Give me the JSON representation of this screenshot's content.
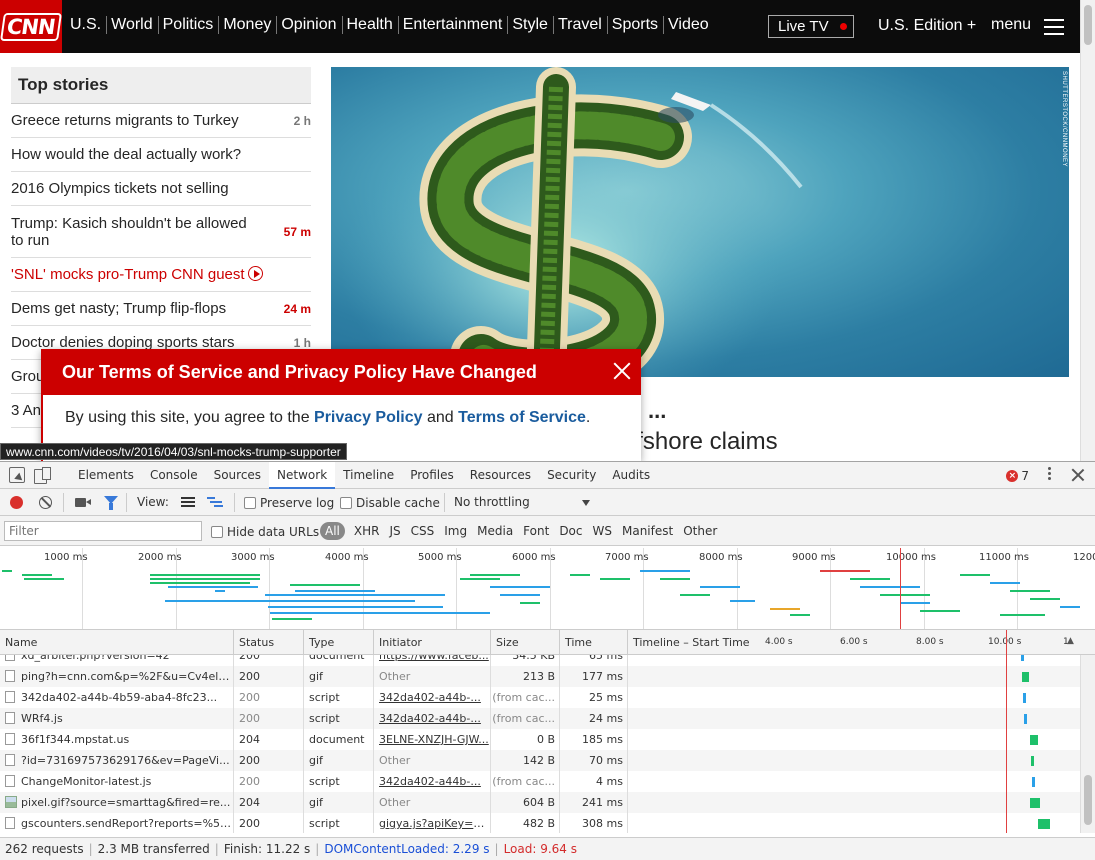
{
  "site": {
    "logo_text": "CNN",
    "nav_links": [
      "U.S.",
      "World",
      "Politics",
      "Money",
      "Opinion",
      "Health",
      "Entertainment",
      "Style",
      "Travel",
      "Sports",
      "Video"
    ],
    "live_tv": "Live TV",
    "edition": "U.S. Edition +",
    "menu": "menu",
    "top_stories": {
      "title": "Top stories",
      "items": [
        {
          "text": "Greece returns migrants to Turkey",
          "age": "2 h",
          "hot": false
        },
        {
          "text": "How would the deal actually work?",
          "age": "",
          "hot": false
        },
        {
          "text": "2016 Olympics tickets not selling",
          "age": "",
          "hot": false
        },
        {
          "text": "Trump: Kasich shouldn't be allowed to run",
          "age": "57 m",
          "hot": true
        },
        {
          "text": "'SNL' mocks pro-Trump CNN guest",
          "age": "",
          "hot": false,
          "video": true
        },
        {
          "text": "Dems get nasty; Trump flip-flops",
          "age": "24 m",
          "hot": true
        },
        {
          "text": "Doctor denies doping sports stars",
          "age": "1 h",
          "hot": false
        },
        {
          "text": "Grou",
          "age": "",
          "hot": false
        },
        {
          "text": "3 An",
          "age": "",
          "hot": false
        }
      ]
    },
    "hero_credit": "SHUTTERSTOCK/CNNMONEY",
    "headline_dots": "...",
    "headline_partial": "ffshore claims",
    "tos": {
      "title": "Our Terms of Service and Privacy Policy Have Changed",
      "body_prefix": "By using this site, you agree to the ",
      "privacy_link": "Privacy Policy",
      "and": " and ",
      "terms_link": "Terms of Service",
      "suffix": "."
    },
    "status_url": "www.cnn.com/videos/tv/2016/04/03/snl-mocks-trump-supporter"
  },
  "devtools": {
    "tabs": [
      "Elements",
      "Console",
      "Sources",
      "Network",
      "Timeline",
      "Profiles",
      "Resources",
      "Security",
      "Audits"
    ],
    "active_tab": "Network",
    "error_count": "7",
    "toolbar": {
      "view_label": "View:",
      "preserve_log": "Preserve log",
      "disable_cache": "Disable cache",
      "throttling": "No throttling"
    },
    "filter": {
      "placeholder": "Filter",
      "hide_data_urls": "Hide data URLs",
      "types": [
        "All",
        "XHR",
        "JS",
        "CSS",
        "Img",
        "Media",
        "Font",
        "Doc",
        "WS",
        "Manifest",
        "Other"
      ]
    },
    "overview_ticks": [
      "1000 ms",
      "2000 ms",
      "3000 ms",
      "4000 ms",
      "5000 ms",
      "6000 ms",
      "7000 ms",
      "8000 ms",
      "9000 ms",
      "10000 ms",
      "11000 ms",
      "1200"
    ],
    "columns": {
      "name": "Name",
      "status": "Status",
      "type": "Type",
      "initiator": "Initiator",
      "size": "Size",
      "time": "Time",
      "timeline": "Timeline – Start Time"
    },
    "waterfall_ticks": [
      "4.00 s",
      "6.00 s",
      "8.00 s",
      "10.00 s",
      "1"
    ],
    "rows": [
      {
        "name": "xd_arbiter.php?version=42",
        "status": "200",
        "type": "document",
        "initiator": "https://www.faceb...",
        "size": "34.5 KB",
        "time": "65 ms",
        "initiator_link": true,
        "icon": "file",
        "wf_start_s": 10.75,
        "wf_dur_s": 0.07,
        "wf_color": "#2aa0e8"
      },
      {
        "name": "ping?h=cnn.com&p=%2F&u=Cv4els...",
        "status": "200",
        "type": "gif",
        "initiator": "Other",
        "size": "213 B",
        "time": "177 ms",
        "initiator_link": false,
        "icon": "file",
        "wf_start_s": 10.8,
        "wf_dur_s": 0.18,
        "wf_color": "#1ec06a"
      },
      {
        "name": "342da402-a44b-4b59-aba4-8fc23...",
        "status": "200",
        "type": "script",
        "initiator": "342da402-a44b-...",
        "size": "(from cac...",
        "time": "25 ms",
        "initiator_link": true,
        "icon": "file",
        "wf_start_s": 10.82,
        "wf_dur_s": 0.05,
        "wf_color": "#2aa0e8"
      },
      {
        "name": "WRf4.js",
        "status": "200",
        "type": "script",
        "initiator": "342da402-a44b-...",
        "size": "(from cac...",
        "time": "24 ms",
        "initiator_link": true,
        "icon": "file",
        "wf_start_s": 10.84,
        "wf_dur_s": 0.05,
        "wf_color": "#2aa0e8"
      },
      {
        "name": "36f1f344.mpstat.us",
        "status": "204",
        "type": "document",
        "initiator": "3ELNE-XNZJH-GJW...",
        "size": "0 B",
        "time": "185 ms",
        "initiator_link": true,
        "icon": "file",
        "wf_start_s": 11.0,
        "wf_dur_s": 0.2,
        "wf_color": "#1ec06a"
      },
      {
        "name": "?id=731697573629176&ev=PageVi...",
        "status": "200",
        "type": "gif",
        "initiator": "Other",
        "size": "142 B",
        "time": "70 ms",
        "initiator_link": false,
        "icon": "file",
        "wf_start_s": 11.02,
        "wf_dur_s": 0.08,
        "wf_color": "#1ec06a"
      },
      {
        "name": "ChangeMonitor-latest.js",
        "status": "200",
        "type": "script",
        "initiator": "342da402-a44b-...",
        "size": "(from cac...",
        "time": "4 ms",
        "initiator_link": true,
        "icon": "file",
        "wf_start_s": 11.04,
        "wf_dur_s": 0.03,
        "wf_color": "#2aa0e8"
      },
      {
        "name": "pixel.gif?source=smarttag&fired=re...",
        "status": "204",
        "type": "gif",
        "initiator": "Other",
        "size": "604 B",
        "time": "241 ms",
        "initiator_link": false,
        "icon": "img",
        "wf_start_s": 11.0,
        "wf_dur_s": 0.26,
        "wf_color": "#1ec06a"
      },
      {
        "name": "gscounters.sendReport?reports=%5B...",
        "status": "200",
        "type": "script",
        "initiator": "gigya.js?apiKey=3...",
        "size": "482 B",
        "time": "308 ms",
        "initiator_link": true,
        "icon": "file",
        "wf_start_s": 11.2,
        "wf_dur_s": 0.32,
        "wf_color": "#1ec06a"
      }
    ],
    "summary": {
      "requests": "262 requests",
      "transferred": "2.3 MB transferred",
      "finish": "Finish: 11.22 s",
      "dom_loaded": "DOMContentLoaded: 2.29 s",
      "load": "Load: 9.64 s"
    }
  }
}
